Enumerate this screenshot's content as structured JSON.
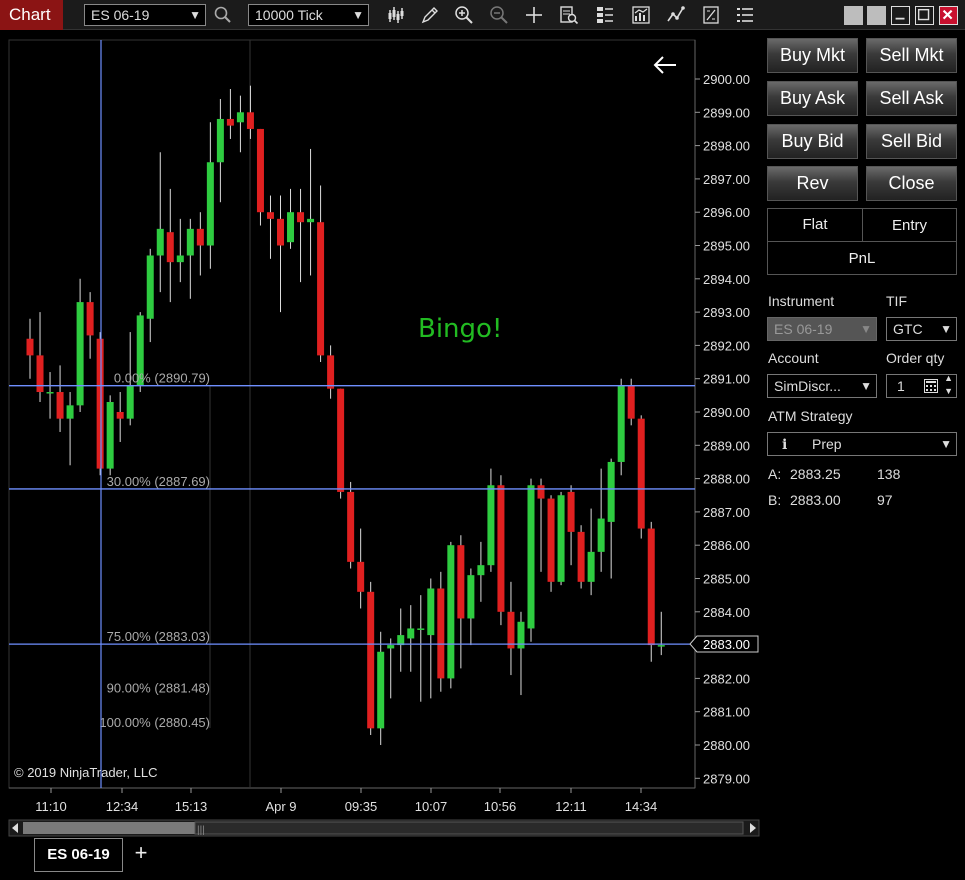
{
  "toolbar": {
    "chart_label": "Chart",
    "instrument": "ES 06-19",
    "interval": "10000 Tick"
  },
  "chart": {
    "annotation": "Bingo!",
    "copyright": "© 2019 NinjaTrader, LLC",
    "current_price_label": "2883.00",
    "colors": {
      "up": "#2ecc40",
      "down": "#e02020",
      "fib": "#6f8fff",
      "text": "#aaaaaa",
      "annotation": "#22bb22"
    },
    "fib_levels": [
      {
        "label": "0.00% (2890.79)",
        "price": 2890.79,
        "line": true
      },
      {
        "label": "30.00% (2887.69)",
        "price": 2887.69,
        "line": true
      },
      {
        "label": "75.00% (2883.03)",
        "price": 2883.03,
        "line": true
      },
      {
        "label": "90.00% (2881.48)",
        "price": 2881.48,
        "line": false
      },
      {
        "label": "100.00% (2880.45)",
        "price": 2880.45,
        "line": false
      }
    ],
    "price_ticks": [
      "2900.00",
      "2899.00",
      "2898.00",
      "2897.00",
      "2896.00",
      "2895.00",
      "2894.00",
      "2893.00",
      "2892.00",
      "2891.00",
      "2890.00",
      "2889.00",
      "2888.00",
      "2887.00",
      "2886.00",
      "2885.00",
      "2884.00",
      "2883.00",
      "2882.00",
      "2881.00",
      "2880.00",
      "2879.00"
    ],
    "time_ticks": [
      "11:10",
      "12:34",
      "15:13",
      "Apr 9",
      "09:35",
      "10:07",
      "10:56",
      "12:11",
      "14:34"
    ],
    "candles": [
      [
        2892.2,
        2891.7,
        2892.8,
        2891.0
      ],
      [
        2891.7,
        2890.6,
        2893.0,
        2890.3
      ],
      [
        2890.6,
        2890.6,
        2891.2,
        2889.8
      ],
      [
        2890.6,
        2889.8,
        2891.4,
        2889.4
      ],
      [
        2889.8,
        2890.2,
        2890.6,
        2888.4
      ],
      [
        2890.2,
        2893.3,
        2894.0,
        2890.0
      ],
      [
        2893.3,
        2892.3,
        2893.6,
        2891.6
      ],
      [
        2892.2,
        2888.3,
        2892.4,
        2888.1
      ],
      [
        2888.3,
        2890.3,
        2890.5,
        2888.1
      ],
      [
        2890.0,
        2889.8,
        2890.6,
        2889.1
      ],
      [
        2889.8,
        2890.8,
        2892.4,
        2889.6
      ],
      [
        2890.8,
        2892.9,
        2893.0,
        2890.6
      ],
      [
        2892.8,
        2894.7,
        2894.9,
        2892.1
      ],
      [
        2894.7,
        2895.5,
        2897.8,
        2893.6
      ],
      [
        2895.4,
        2894.5,
        2896.7,
        2893.3
      ],
      [
        2894.5,
        2894.7,
        2895.8,
        2893.9
      ],
      [
        2894.7,
        2895.5,
        2895.8,
        2893.4
      ],
      [
        2895.5,
        2895.0,
        2896.0,
        2894.1
      ],
      [
        2895.0,
        2897.5,
        2898.7,
        2894.3
      ],
      [
        2897.5,
        2898.8,
        2899.4,
        2896.3
      ],
      [
        2898.8,
        2898.6,
        2899.7,
        2898.2
      ],
      [
        2898.7,
        2899.0,
        2899.5,
        2897.8
      ],
      [
        2899.0,
        2898.5,
        2899.8,
        2898.2
      ],
      [
        2898.5,
        2896.0,
        2898.5,
        2895.6
      ],
      [
        2896.0,
        2895.8,
        2896.5,
        2894.6
      ],
      [
        2895.8,
        2895.0,
        2896.5,
        2893.0
      ],
      [
        2895.1,
        2896.0,
        2896.7,
        2894.9
      ],
      [
        2896.0,
        2895.7,
        2896.7,
        2893.9
      ],
      [
        2895.7,
        2895.8,
        2897.9,
        2894.1
      ],
      [
        2895.7,
        2891.7,
        2896.8,
        2891.5
      ],
      [
        2891.7,
        2890.7,
        2892.0,
        2890.4
      ],
      [
        2890.7,
        2887.6,
        2890.7,
        2887.4
      ],
      [
        2887.6,
        2885.5,
        2887.9,
        2885.3
      ],
      [
        2885.5,
        2884.6,
        2886.5,
        2884.1
      ],
      [
        2884.6,
        2880.5,
        2884.9,
        2880.3
      ],
      [
        2880.5,
        2882.8,
        2883.4,
        2880.0
      ],
      [
        2882.9,
        2883.0,
        2883.2,
        2881.4
      ],
      [
        2883.0,
        2883.3,
        2884.1,
        2882.2
      ],
      [
        2883.2,
        2883.5,
        2884.2,
        2882.2
      ],
      [
        2883.5,
        2883.5,
        2884.5,
        2881.3
      ],
      [
        2883.3,
        2884.7,
        2885.0,
        2881.4
      ],
      [
        2884.7,
        2882.0,
        2885.2,
        2881.6
      ],
      [
        2882.0,
        2886.0,
        2886.1,
        2881.7
      ],
      [
        2886.0,
        2883.8,
        2886.3,
        2882.3
      ],
      [
        2883.8,
        2885.1,
        2885.3,
        2883.0
      ],
      [
        2885.1,
        2885.4,
        2886.1,
        2884.3
      ],
      [
        2885.4,
        2887.8,
        2888.3,
        2885.2
      ],
      [
        2887.8,
        2884.0,
        2888.1,
        2883.6
      ],
      [
        2884.0,
        2882.9,
        2884.9,
        2882.1
      ],
      [
        2882.9,
        2883.7,
        2884.0,
        2881.5
      ],
      [
        2883.5,
        2887.8,
        2888.0,
        2883.1
      ],
      [
        2887.8,
        2887.4,
        2888.0,
        2885.2
      ],
      [
        2887.4,
        2884.9,
        2887.5,
        2884.6
      ],
      [
        2884.9,
        2887.5,
        2887.6,
        2884.8
      ],
      [
        2887.6,
        2886.4,
        2887.8,
        2885.4
      ],
      [
        2886.4,
        2884.9,
        2886.6,
        2884.7
      ],
      [
        2884.9,
        2885.8,
        2887.1,
        2884.5
      ],
      [
        2885.8,
        2886.8,
        2888.3,
        2885.2
      ],
      [
        2886.7,
        2888.5,
        2888.6,
        2885.0
      ],
      [
        2888.5,
        2890.8,
        2891.0,
        2888.1
      ],
      [
        2890.8,
        2889.8,
        2891.0,
        2889.6
      ],
      [
        2889.8,
        2886.5,
        2889.9,
        2886.2
      ],
      [
        2886.5,
        2883.0,
        2886.7,
        2882.5
      ],
      [
        2883.0,
        2883.0,
        2884.0,
        2882.7
      ]
    ]
  },
  "panel": {
    "buy_mkt": "Buy Mkt",
    "sell_mkt": "Sell Mkt",
    "buy_ask": "Buy Ask",
    "sell_ask": "Sell Ask",
    "buy_bid": "Buy Bid",
    "sell_bid": "Sell Bid",
    "rev": "Rev",
    "close": "Close",
    "flat": "Flat",
    "entry": "Entry",
    "pnl": "PnL",
    "instrument_label": "Instrument",
    "tif_label": "TIF",
    "instrument_value": "ES 06-19",
    "tif_value": "GTC",
    "account_label": "Account",
    "order_qty_label": "Order qty",
    "account_value": "SimDiscr...",
    "order_qty_value": "1",
    "atm_label": "ATM Strategy",
    "atm_value": "Prep",
    "ask_label": "A:",
    "ask_price": "2883.25",
    "ask_size": "138",
    "bid_label": "B:",
    "bid_price": "2883.00",
    "bid_size": "97"
  },
  "bottom": {
    "tab_label": "ES 06-19",
    "add_label": "+"
  }
}
